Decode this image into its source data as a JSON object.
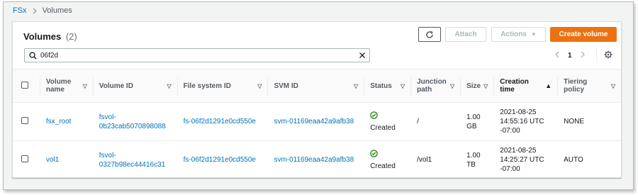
{
  "breadcrumb": {
    "root": "FSx",
    "current": "Volumes"
  },
  "panel": {
    "title": "Volumes",
    "count": "(2)",
    "buttons": {
      "attach": "Attach",
      "actions": "Actions",
      "create": "Create volume"
    },
    "search": {
      "value": "06f2d"
    },
    "pager": {
      "page": "1"
    }
  },
  "columns": [
    {
      "line1": "Volume",
      "line2": "name"
    },
    {
      "line1": "Volume ID",
      "line2": ""
    },
    {
      "line1": "File system ID",
      "line2": ""
    },
    {
      "line1": "SVM ID",
      "line2": ""
    },
    {
      "line1": "Status",
      "line2": ""
    },
    {
      "line1": "Junction",
      "line2": "path"
    },
    {
      "line1": "Size",
      "line2": ""
    },
    {
      "line1": "Creation",
      "line2": "time"
    },
    {
      "line1": "Tiering",
      "line2": "policy"
    }
  ],
  "rows": [
    {
      "name": "fsx_root",
      "volume_id_1": "fsvol-",
      "volume_id_2": "0b23cab5070898088",
      "fs_id": "fs-06f2d1291e0cd550e",
      "svm_id": "svm-01169eaa42a9afb38",
      "status": "Created",
      "junction": "/",
      "size_1": "1.00",
      "size_2": "GB",
      "time_1": "2021-08-25",
      "time_2": "14:55:16 UTC",
      "time_3": "-07:00",
      "tiering": "NONE"
    },
    {
      "name": "vol1",
      "volume_id_1": "fsvol-",
      "volume_id_2": "0327b98ec44416c31",
      "fs_id": "fs-06f2d1291e0cd550e",
      "svm_id": "svm-01169eaa42a9afb38",
      "status": "Created",
      "junction": "/vol1",
      "size_1": "1.00",
      "size_2": "TB",
      "time_1": "2021-08-25",
      "time_2": "14:25:27 UTC",
      "time_3": "-07:00",
      "tiering": "AUTO"
    }
  ],
  "colors": {
    "link": "#0073bb",
    "primary": "#ec7211",
    "success": "#1d8102"
  }
}
